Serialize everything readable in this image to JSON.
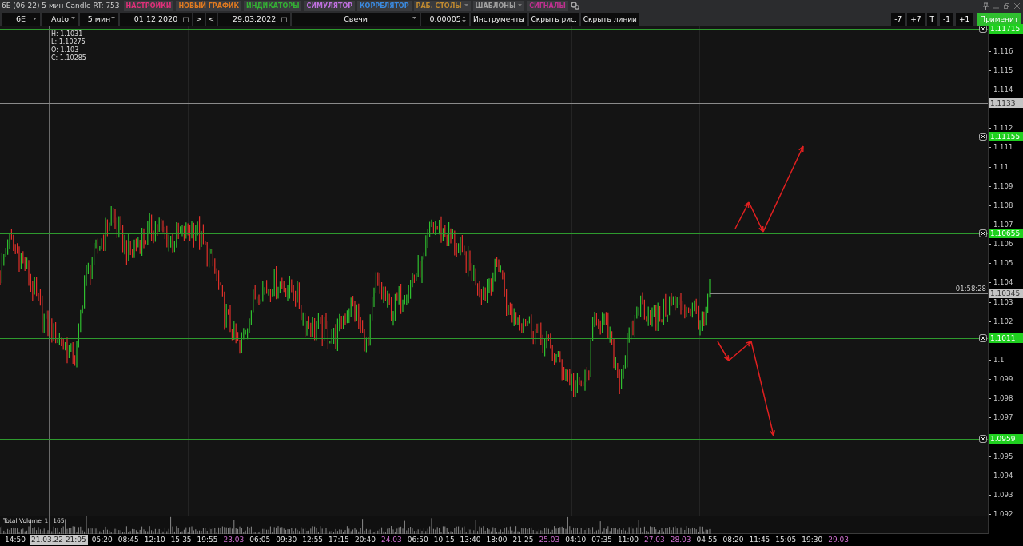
{
  "window": {
    "title": "6E (06-22) 5 мин Candle RT: 753"
  },
  "menu": [
    {
      "label": "НАСТРОЙКИ",
      "color": "#e0307a",
      "has_menu": false
    },
    {
      "label": "НОВЫЙ ГРАФИК",
      "color": "#e07a20",
      "has_menu": false
    },
    {
      "label": "ИНДИКАТОРЫ",
      "color": "#34b034",
      "has_menu": false
    },
    {
      "label": "СИМУЛЯТОР",
      "color": "#c070e0",
      "has_menu": false
    },
    {
      "label": "КОРРЕЛЯТОР",
      "color": "#3a8ae0",
      "has_menu": false
    },
    {
      "label": "РАБ. СТОЛЫ",
      "color": "#c08a30",
      "has_menu": true
    },
    {
      "label": "ШАБЛОНЫ",
      "color": "#a0a0a0",
      "has_menu": true
    },
    {
      "label": "СИГНАЛЫ",
      "color": "#c03090",
      "has_menu": false
    }
  ],
  "toolbar": [
    {
      "kind": "symbol",
      "value": "6E"
    },
    {
      "kind": "select",
      "value": "Auto"
    },
    {
      "kind": "select",
      "value": "5 мин"
    },
    {
      "kind": "date",
      "value": "01.12.2020"
    },
    {
      "kind": "button",
      "value": ">"
    },
    {
      "kind": "button",
      "value": "<"
    },
    {
      "kind": "date",
      "value": "29.03.2022"
    },
    {
      "kind": "select",
      "value": "Свечи"
    },
    {
      "kind": "spinner",
      "value": "0.00005"
    },
    {
      "kind": "button",
      "value": "Инструменты"
    },
    {
      "kind": "button",
      "value": "Скрыть рис."
    },
    {
      "kind": "button",
      "value": "Скрыть линии"
    }
  ],
  "right_buttons": [
    {
      "label": "-7",
      "kind": "plain"
    },
    {
      "label": "+7",
      "kind": "plain"
    },
    {
      "label": "T",
      "kind": "plain"
    },
    {
      "label": "-1",
      "kind": "plain"
    },
    {
      "label": "+1",
      "kind": "plain"
    },
    {
      "label": "Применит",
      "kind": "apply"
    }
  ],
  "chart": {
    "ohlc": [
      "H: 1.1031",
      "L: 1.10275",
      "O: 1.103",
      "C: 1.10285"
    ],
    "levels": [
      {
        "price": "1.11715",
        "kind": "drawn"
      },
      {
        "price": "1.1133",
        "kind": "mark"
      },
      {
        "price": "1.11155",
        "kind": "drawn"
      },
      {
        "price": "1.10655",
        "kind": "drawn"
      },
      {
        "price": "1.10345",
        "kind": "current",
        "timer": "01:58:28"
      },
      {
        "price": "1.1011",
        "kind": "drawn"
      },
      {
        "price": "1.0959",
        "kind": "drawn"
      }
    ],
    "yticks": [
      "1.116",
      "1.115",
      "1.114",
      "1.112",
      "1.111",
      "1.11",
      "1.109",
      "1.108",
      "1.107",
      "1.106",
      "1.105",
      "1.104",
      "1.103",
      "1.102",
      "1.1",
      "1.099",
      "1.098",
      "1.097",
      "1.095",
      "1.094",
      "1.093",
      "1.092"
    ],
    "volume": {
      "label": "Total Volume_1",
      "value": "165"
    },
    "xlabels": [
      {
        "text": "14:50",
        "kind": "time"
      },
      {
        "text": "21.03.22 21:05",
        "kind": "crosshair"
      },
      {
        "text": "05:20",
        "kind": "time"
      },
      {
        "text": "08:45",
        "kind": "time"
      },
      {
        "text": "12:10",
        "kind": "time"
      },
      {
        "text": "15:35",
        "kind": "time"
      },
      {
        "text": "19:55",
        "kind": "time"
      },
      {
        "text": "23.03",
        "kind": "date"
      },
      {
        "text": "06:05",
        "kind": "time"
      },
      {
        "text": "09:30",
        "kind": "time"
      },
      {
        "text": "12:55",
        "kind": "time"
      },
      {
        "text": "17:15",
        "kind": "time"
      },
      {
        "text": "20:40",
        "kind": "time"
      },
      {
        "text": "24.03",
        "kind": "date"
      },
      {
        "text": "06:50",
        "kind": "time"
      },
      {
        "text": "10:15",
        "kind": "time"
      },
      {
        "text": "13:40",
        "kind": "time"
      },
      {
        "text": "18:00",
        "kind": "time"
      },
      {
        "text": "21:25",
        "kind": "time"
      },
      {
        "text": "25.03",
        "kind": "date"
      },
      {
        "text": "04:10",
        "kind": "time"
      },
      {
        "text": "07:35",
        "kind": "time"
      },
      {
        "text": "11:00",
        "kind": "time"
      },
      {
        "text": "27.03",
        "kind": "date"
      },
      {
        "text": "28.03",
        "kind": "date"
      },
      {
        "text": "04:55",
        "kind": "time"
      },
      {
        "text": "08:20",
        "kind": "time"
      },
      {
        "text": "11:45",
        "kind": "time"
      },
      {
        "text": "15:05",
        "kind": "time"
      },
      {
        "text": "19:30",
        "kind": "time"
      },
      {
        "text": "29.03",
        "kind": "date"
      }
    ]
  }
}
